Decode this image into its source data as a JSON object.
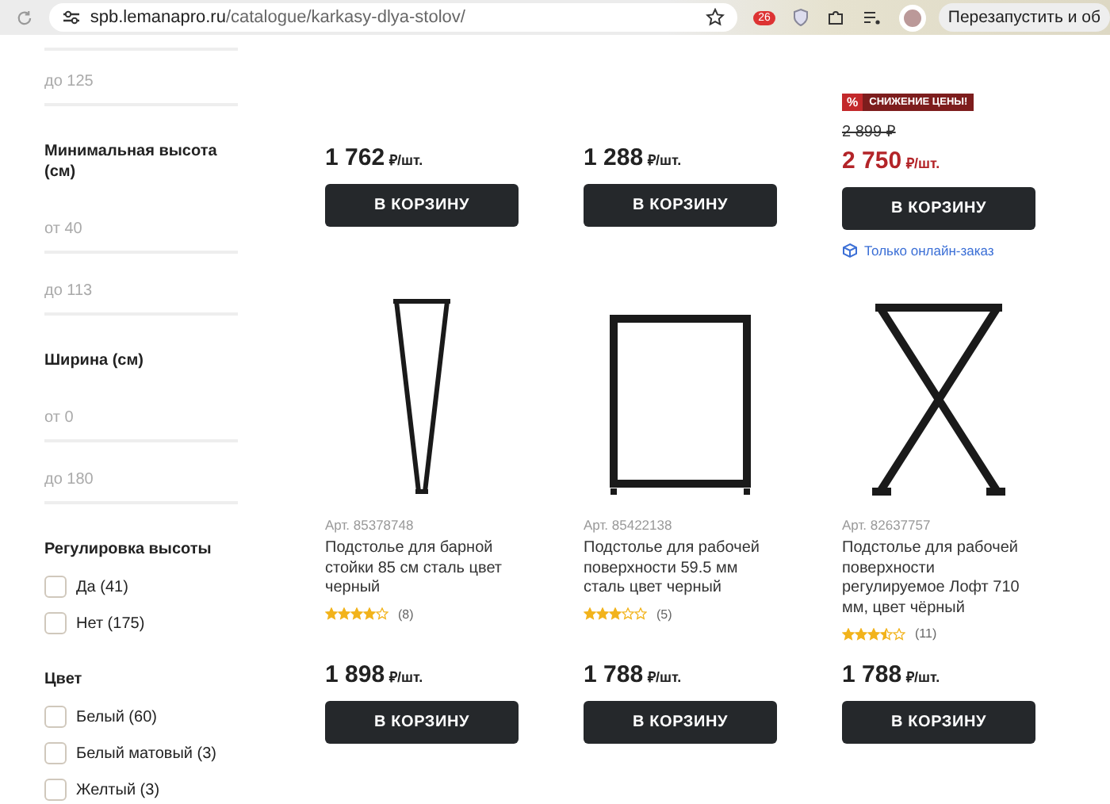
{
  "browser": {
    "url_host": "spb.lemanapro.ru",
    "url_path": "/catalogue/karkasy-dlya-stolov/",
    "extension_badge": "26",
    "relaunch_button": "Перезапустить и об"
  },
  "filters": [
    {
      "kind": "range",
      "fields": [
        {
          "placeholder": "до 125"
        }
      ]
    },
    {
      "kind": "range",
      "title": "Минимальная высота (см)",
      "fields": [
        {
          "placeholder": "от 40"
        },
        {
          "placeholder": "до 113"
        }
      ]
    },
    {
      "kind": "range",
      "title": "Ширина (см)",
      "fields": [
        {
          "placeholder": "от 0"
        },
        {
          "placeholder": "до 180"
        }
      ]
    },
    {
      "kind": "checks",
      "title": "Регулировка высоты",
      "options": [
        {
          "label": "Да (41)",
          "checked": false
        },
        {
          "label": "Нет (175)",
          "checked": false
        }
      ]
    },
    {
      "kind": "checks",
      "title": "Цвет",
      "options": [
        {
          "label": "Белый (60)",
          "checked": false
        },
        {
          "label": "Белый матовый (3)",
          "checked": false
        },
        {
          "label": "Желтый (3)",
          "checked": false
        }
      ]
    }
  ],
  "products_top": [
    {
      "price": "1 762",
      "unit": "₽/шт.",
      "discounted": false,
      "button": "В КОРЗИНУ"
    },
    {
      "price": "1 288",
      "unit": "₽/шт.",
      "discounted": false,
      "button": "В КОРЗИНУ"
    },
    {
      "badge": "СНИЖЕНИЕ ЦЕНЫ!",
      "badge_icon": "%",
      "old_price": "2 899 ₽",
      "price": "2 750",
      "unit": "₽/шт.",
      "discounted": true,
      "button": "В КОРЗИНУ",
      "note": "Только онлайн-заказ"
    }
  ],
  "products": [
    {
      "kind": "v-leg",
      "art": "Арт. 85378748",
      "title": "Подстолье для барной стойки 85 см сталь цвет черный",
      "stars": 4,
      "reviews": "(8)",
      "price": "1 898",
      "unit": "₽/шт.",
      "button": "В КОРЗИНУ"
    },
    {
      "kind": "frame",
      "art": "Арт. 85422138",
      "title": "Подстолье для рабочей поверхности 59.5 мм сталь цвет черный",
      "stars": 3,
      "reviews": "(5)",
      "price": "1 788",
      "unit": "₽/шт.",
      "button": "В КОРЗИНУ"
    },
    {
      "kind": "x-leg",
      "art": "Арт. 82637757",
      "title": "Подстолье для рабочей поверхности регулируемое Лофт 710 мм, цвет чёрный",
      "stars": 3.5,
      "reviews": "(11)",
      "price": "1 788",
      "unit": "₽/шт.",
      "button": "В КОРЗИНУ"
    }
  ]
}
